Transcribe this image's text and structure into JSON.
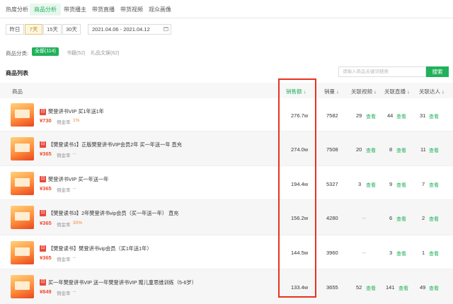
{
  "tabs": [
    "热度分析",
    "商品分析",
    "带货播主",
    "带货直播",
    "带货视频",
    "观众画像"
  ],
  "days": [
    "昨日",
    "7天",
    "15天",
    "30天"
  ],
  "date_range": "2021.04.06 - 2021.04.12",
  "categories": {
    "label": "商品分类:",
    "active": "全部(114)",
    "items": [
      "书籍(52)",
      "礼品文娱(62)"
    ]
  },
  "list_title": "商品列表",
  "search": {
    "placeholder": "请输入商品关键词搜索",
    "button": "搜索"
  },
  "table": {
    "headers": [
      "商品",
      "销售额 ↓",
      "销量 ↓",
      "关联视频 ↓",
      "关联直播 ↓",
      "关联达人 ↓"
    ],
    "look_label": "查看",
    "commission_label": "佣金率",
    "rows": [
      {
        "tag": "日",
        "name": "樊登讲书VIP 买1年送1年",
        "price": "¥730",
        "commission": "1%",
        "sales": "276.7w",
        "volume": "7582",
        "videos": "29",
        "lives": "44",
        "creators": "31"
      },
      {
        "tag": "日",
        "name": "【樊登读书1】正版樊登讲书VIP会员2年 买一年送一年 直充",
        "price": "¥365",
        "commission": "--",
        "sales": "274.0w",
        "volume": "7508",
        "videos": "20",
        "lives": "8",
        "creators": "11"
      },
      {
        "tag": "日",
        "name": "樊登讲书VIP 买一年送一年",
        "price": "¥365",
        "commission": "--",
        "sales": "194.4w",
        "volume": "5327",
        "videos": "3",
        "lives": "9",
        "creators": "7"
      },
      {
        "tag": "日",
        "name": "【樊登读书3】2年樊登讲书vip会员（买一年送一年） 直充",
        "price": "¥365",
        "commission": "30%",
        "sales": "156.2w",
        "volume": "4280",
        "videos": "--",
        "lives": "6",
        "creators": "2"
      },
      {
        "tag": "日",
        "name": "【樊登读书】樊登讲书vip会员（买1年送1年）",
        "price": "¥365",
        "commission": "--",
        "sales": "144.5w",
        "volume": "3960",
        "videos": "--",
        "lives": "3",
        "creators": "1"
      },
      {
        "tag": "日",
        "name": "买一年樊登讲书VIP 送一年樊登讲书VIP 赠儿童思维训练（5-6岁）",
        "price": "¥849",
        "commission": "--",
        "sales": "133.4w",
        "volume": "3655",
        "videos": "52",
        "lives": "141",
        "creators": "49"
      }
    ]
  }
}
